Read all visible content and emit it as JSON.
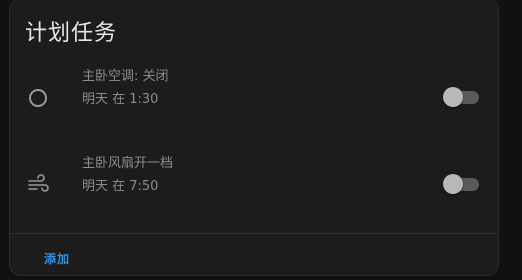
{
  "card": {
    "title": "计划任务"
  },
  "tasks": [
    {
      "name": "主卧空调: 关闭",
      "time": "明天 在 1:30",
      "icon": "circle-outline-icon",
      "enabled": false
    },
    {
      "name": "主卧风扇开一档",
      "time": "明天 在 7:50",
      "icon": "fan-wind-icon",
      "enabled": false
    }
  ],
  "footer": {
    "add_label": "添加"
  },
  "colors": {
    "accent": "#2e93e6",
    "card_background": "#1c1c1c",
    "page_background": "#111111"
  }
}
